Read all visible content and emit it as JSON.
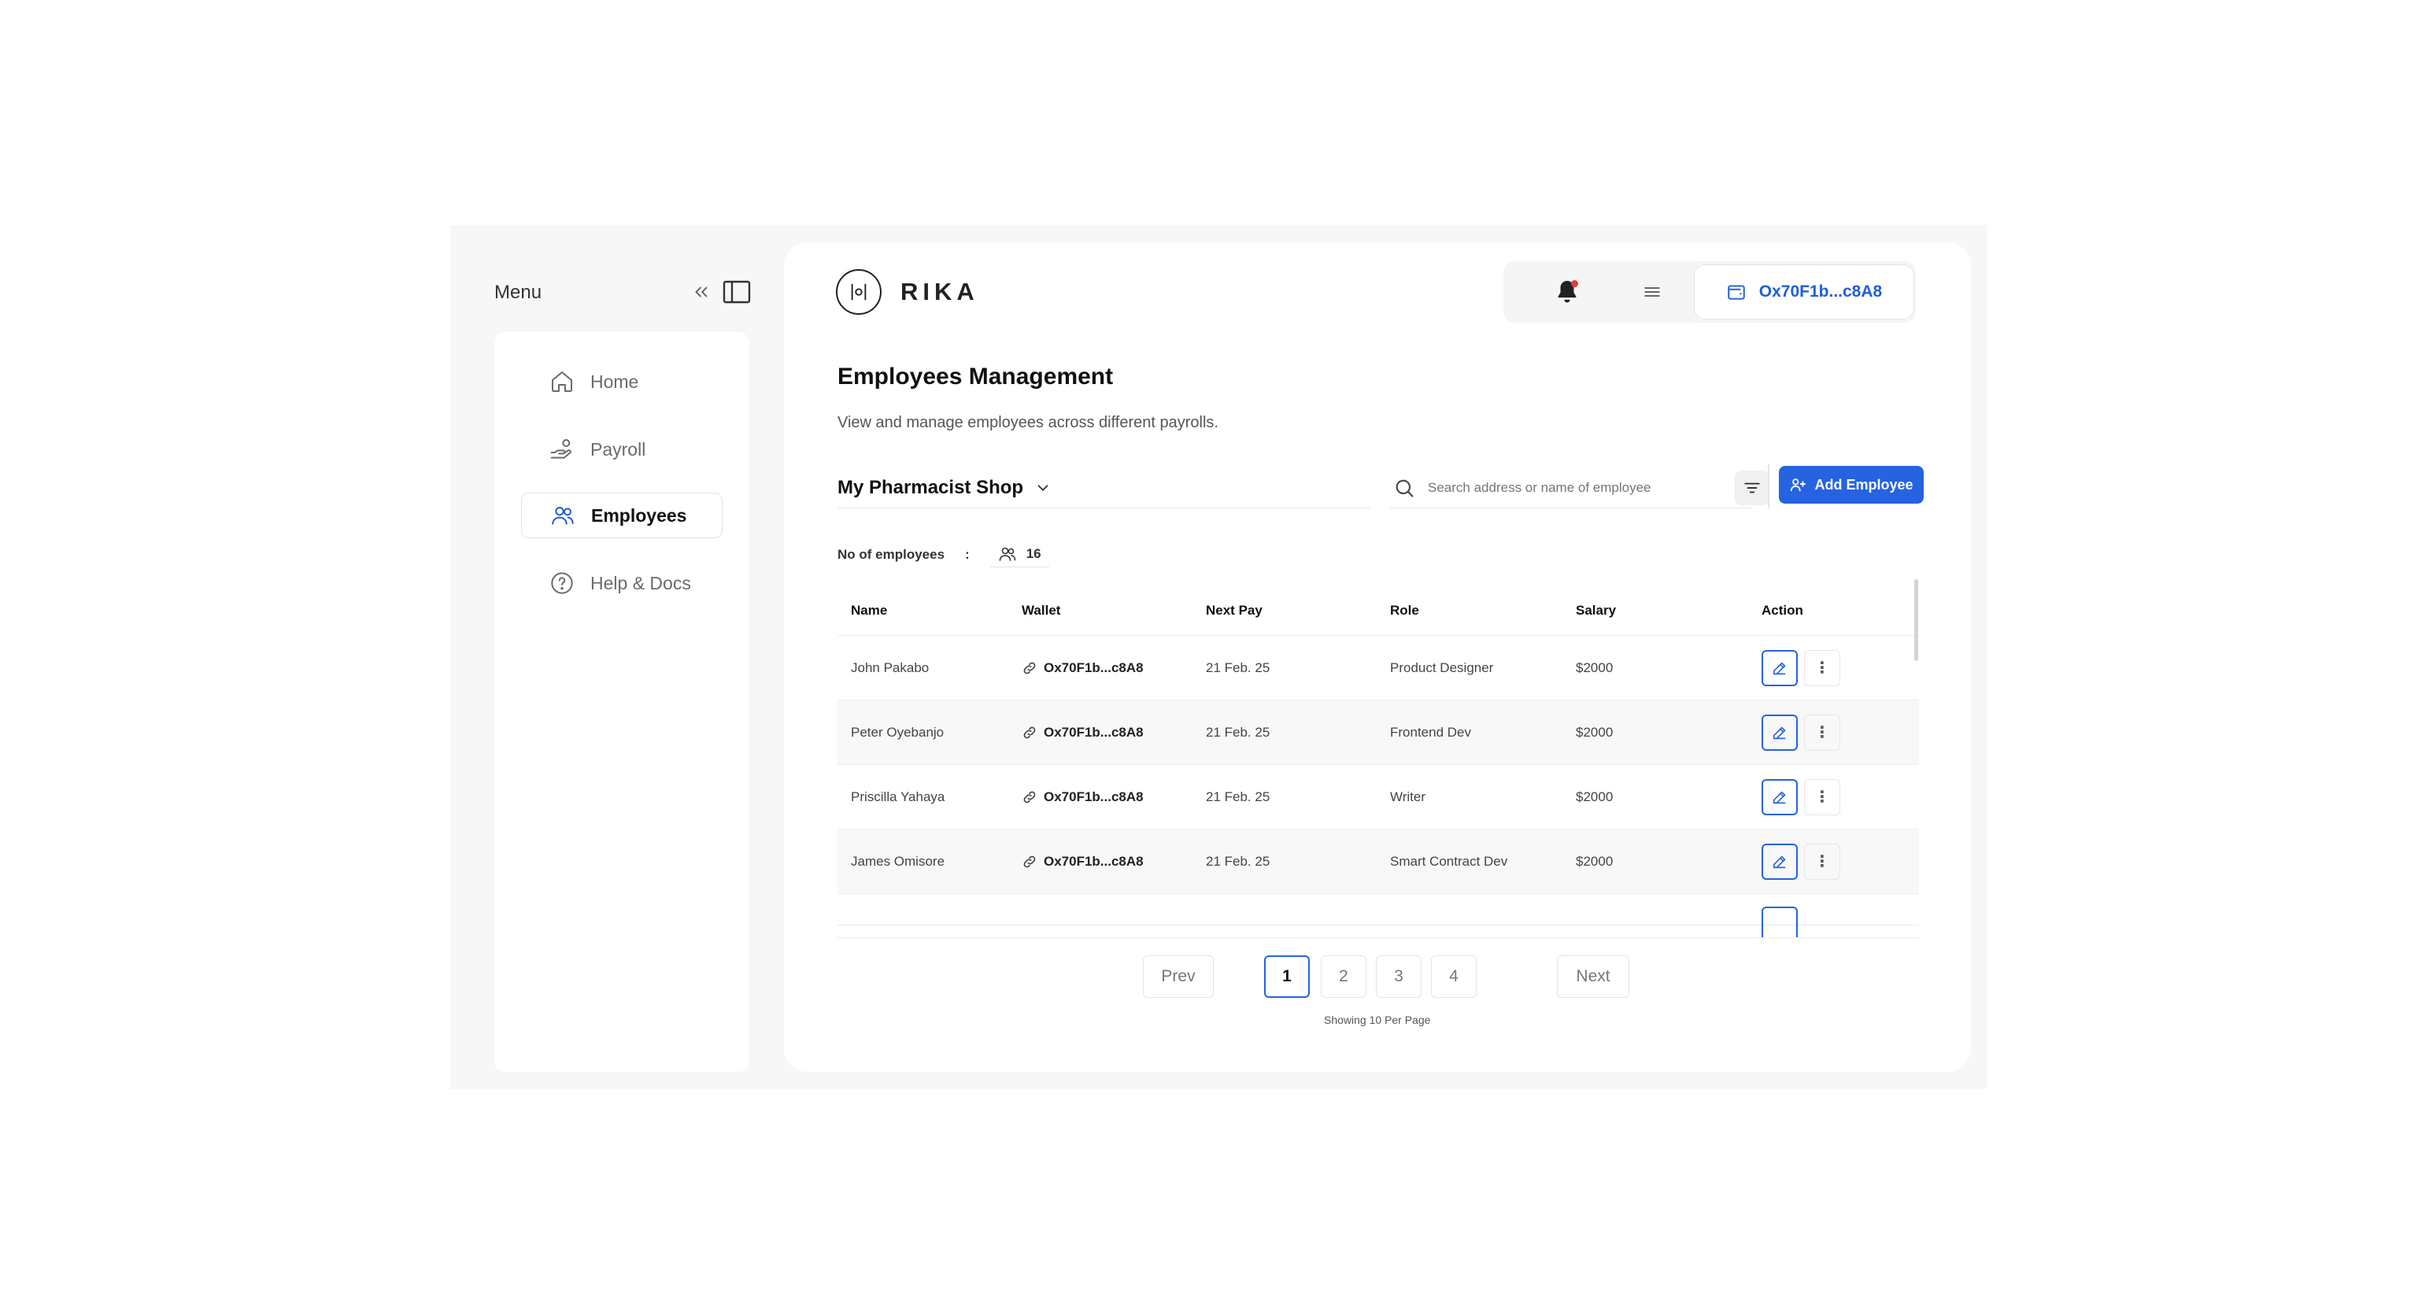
{
  "sidebar": {
    "menu_title": "Menu",
    "items": [
      {
        "label": "Home",
        "icon": "home-icon",
        "active": false
      },
      {
        "label": "Payroll",
        "icon": "payroll-hand-icon",
        "active": false
      },
      {
        "label": "Employees",
        "icon": "users-icon",
        "active": true
      },
      {
        "label": "Help & Docs",
        "icon": "help-circle-icon",
        "active": false
      }
    ]
  },
  "header": {
    "logo_text": "RIKA",
    "wallet_address": "Ox70F1b...c8A8",
    "notification_dot_color": "#e03a3a"
  },
  "page": {
    "title": "Employees Management",
    "subtitle": "View and manage employees across different payrolls."
  },
  "toolbar": {
    "shop_name": "My Pharmacist Shop",
    "search_placeholder": "Search address or name of employee",
    "add_button_label": "Add Employee",
    "accent_color": "#2563e0"
  },
  "stats": {
    "employees_label": "No of employees",
    "separator": ":",
    "employees_count": "16"
  },
  "table": {
    "headers": [
      "Name",
      "Wallet",
      "Next Pay",
      "Role",
      "Salary",
      "Action"
    ],
    "rows": [
      {
        "name": "John Pakabo",
        "wallet": "Ox70F1b...c8A8",
        "next_pay": "21 Feb. 25",
        "role": "Product Designer",
        "salary": "$2000"
      },
      {
        "name": "Peter Oyebanjo",
        "wallet": "Ox70F1b...c8A8",
        "next_pay": "21 Feb. 25",
        "role": "Frontend Dev",
        "salary": "$2000"
      },
      {
        "name": "Priscilla Yahaya",
        "wallet": "Ox70F1b...c8A8",
        "next_pay": "21 Feb. 25",
        "role": "Writer",
        "salary": "$2000"
      },
      {
        "name": "James Omisore",
        "wallet": "Ox70F1b...c8A8",
        "next_pay": "21 Feb. 25",
        "role": "Smart Contract Dev",
        "salary": "$2000"
      }
    ]
  },
  "pagination": {
    "prev": "Prev",
    "next": "Next",
    "pages": [
      "1",
      "2",
      "3",
      "4"
    ],
    "current": "1",
    "per_page_text": "Showing 10 Per Page"
  }
}
